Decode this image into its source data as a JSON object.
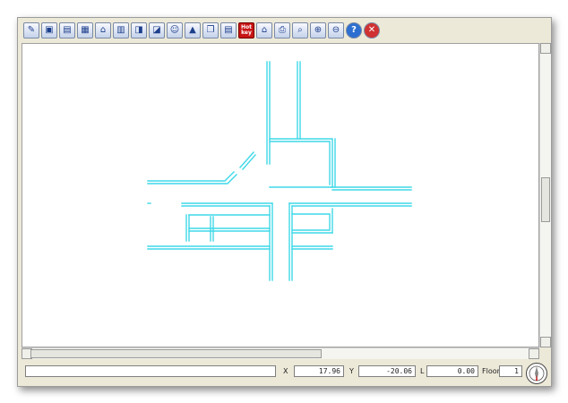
{
  "toolbar": {
    "buttons": [
      {
        "name": "edit-button",
        "glyph": "✎"
      },
      {
        "name": "open-button",
        "glyph": "▣"
      },
      {
        "name": "save-button",
        "glyph": "▤"
      },
      {
        "name": "calendar-button",
        "glyph": "▦"
      },
      {
        "name": "house-button",
        "glyph": "⌂"
      },
      {
        "name": "wall-button",
        "glyph": "▥"
      },
      {
        "name": "add-button",
        "glyph": "◨"
      },
      {
        "name": "edit-plan-button",
        "glyph": "◪"
      },
      {
        "name": "user-button",
        "glyph": "☺"
      },
      {
        "name": "tent-button",
        "glyph": "▲"
      },
      {
        "name": "copy-button",
        "glyph": "❐"
      },
      {
        "name": "document-button",
        "glyph": "▤"
      },
      {
        "name": "hotkey-button",
        "glyph": "Hot key",
        "style": "hot"
      },
      {
        "name": "home-button",
        "glyph": "⌂"
      },
      {
        "name": "print-button",
        "glyph": "⎙"
      },
      {
        "name": "search-button",
        "glyph": "⌕"
      },
      {
        "name": "zoom-in-button",
        "glyph": "⊕"
      },
      {
        "name": "zoom-out-button",
        "glyph": "⊖"
      },
      {
        "name": "help-button",
        "glyph": "?",
        "style": "help"
      },
      {
        "name": "close-button",
        "glyph": "✕",
        "style": "stop"
      }
    ]
  },
  "status": {
    "message": "",
    "x_label": "X",
    "x_value": "17.96",
    "y_label": "Y",
    "y_value": "-20.06",
    "l_label": "L",
    "l_value": "0.00",
    "floor_label": "Floor",
    "floor_value": "1"
  },
  "colors": {
    "wall": "#3ed8e8"
  }
}
